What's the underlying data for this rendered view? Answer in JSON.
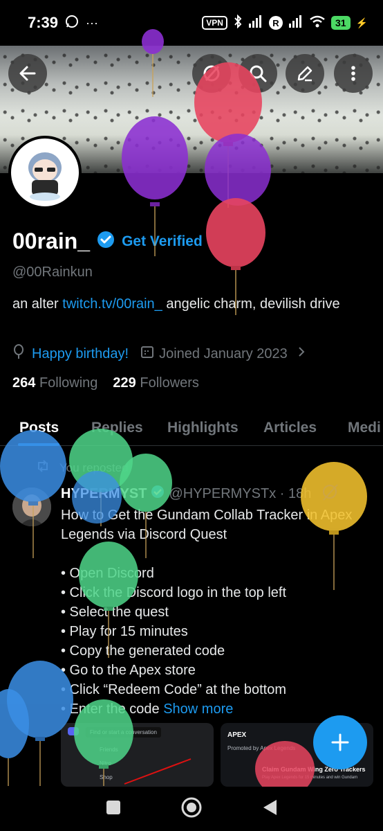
{
  "status_bar": {
    "time": "7:39",
    "vpn_label": "VPN",
    "carrier_badge": "R",
    "battery": "31",
    "icons": [
      "whatsapp-icon",
      "more-dots-icon",
      "bluetooth-icon",
      "signal-icon",
      "wifi-icon",
      "charging-icon"
    ]
  },
  "header": {
    "buttons": [
      "back-arrow-icon",
      "grok-icon",
      "search-icon",
      "edit-icon",
      "more-vertical-icon"
    ]
  },
  "profile": {
    "display_name": "00rain_",
    "get_verified": "Get Verified",
    "handle": "@00Rainkun",
    "bio_prefix": "an alter",
    "bio_link": "twitch.tv/00rain_",
    "bio_suffix": " angelic charm, devilish drive",
    "birthday": "Happy birthday!",
    "joined": "Joined January 2023",
    "following_count": "264",
    "following_label": "Following",
    "followers_count": "229",
    "followers_label": "Followers"
  },
  "tabs": [
    "Posts",
    "Replies",
    "Highlights",
    "Articles",
    "Medi"
  ],
  "post": {
    "repost_label": "You reposted",
    "author_name": "HYPERMYST",
    "author_handle": "@HYPERMYSTx · 18h",
    "body_lines": [
      "How to Get the Gundam Collab Tracker in Apex",
      "Legends via Discord Quest",
      "",
      "• Open Discord",
      "• Click the Discord logo in the top left",
      "• Select the quest",
      "• Play for 15 minutes",
      "• Copy the generated code",
      "• Go to the Apex store",
      "• Click “Redeem Code” at the bottom",
      "• Enter the code"
    ],
    "show_more": "Show more",
    "media_left_text": "Find or start a conversation",
    "media_left_items": [
      "Friends",
      "Nitro",
      "Shop"
    ],
    "media_right_brand": "APEX",
    "media_right_promo": "Promoted by Apex Legends",
    "media_right_title": "Claim Gundam Wing Zero Trackers",
    "media_right_sub": "Play Apex Legends for 15 minutes and win Gundam"
  },
  "fab_icon": "plus-icon",
  "navbar": [
    "recents-square-icon",
    "home-circle-icon",
    "back-triangle-icon"
  ],
  "colors": {
    "accent": "#1d9bf0",
    "muted": "#71767b",
    "balloon_red": "#e8445f",
    "balloon_purple": "#8b2fd1",
    "balloon_blue": "#3b8fe6",
    "balloon_green": "#4fd68a",
    "balloon_yellow": "#f2c12e"
  }
}
